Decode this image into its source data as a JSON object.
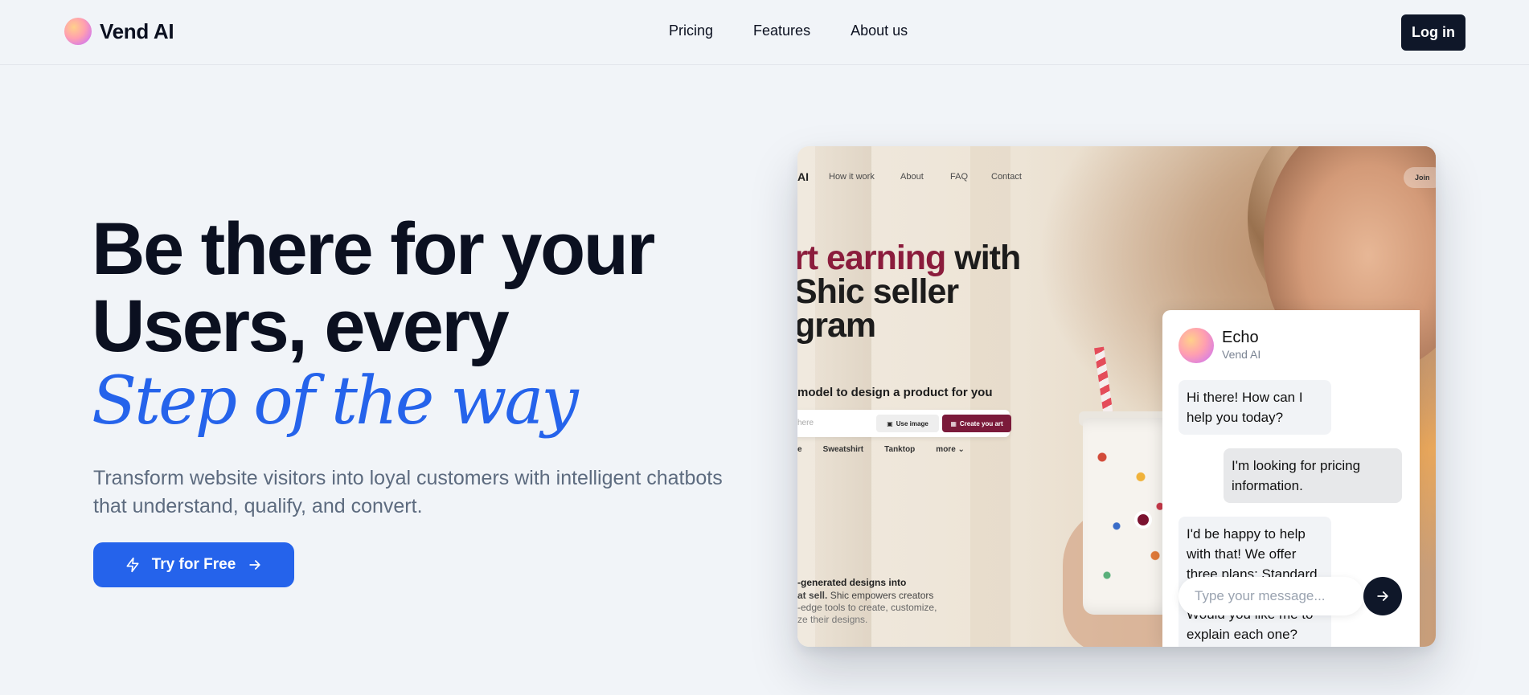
{
  "brand": {
    "name": "Vend AI"
  },
  "nav": {
    "items": [
      "Pricing",
      "Features",
      "About us"
    ],
    "login_label": "Log in"
  },
  "hero": {
    "title_line1": "Be there for your",
    "title_line2": "Users, every",
    "title_accent": "Step of the way",
    "subtitle": "Transform website visitors into loyal customers with intelligent chatbots that understand, qualify, and convert.",
    "cta_label": "Try for Free"
  },
  "preview": {
    "nav": {
      "logo": "AI",
      "links": [
        "How it work",
        "About",
        "FAQ",
        "Contact"
      ],
      "join": "Join"
    },
    "headline_pink": "rt earning",
    "headline_rest1": " with",
    "headline_line2": " Shic seller",
    "headline_line3": "gram",
    "model_text": "model to design a product for you",
    "search_placeholder": "here",
    "use_image": "Use image",
    "create_art": "Create you art",
    "tags": [
      "e",
      "Sweatshirt",
      "Tanktop",
      "more ⌄"
    ],
    "footer_line1": "-generated designs into",
    "footer_line2_bold": "at sell.",
    "footer_line2_rest": " Shic empowers creators",
    "footer_line3": "-edge tools to create, customize,",
    "footer_line4": "ze their designs."
  },
  "chat": {
    "name": "Echo",
    "subtitle": "Vend AI",
    "messages": [
      {
        "from": "bot",
        "text": "Hi there! How can I help you today?"
      },
      {
        "from": "user",
        "text": "I'm looking for pricing information."
      },
      {
        "from": "bot",
        "text": "I'd be happy to help with that! We offer three plans: Standard, Pro, and Enterprise. Would you like me to explain each one?"
      }
    ],
    "input_placeholder": "Type your message..."
  },
  "colors": {
    "accent": "#2563eb",
    "dark": "#0f1729",
    "background": "#f1f4f8",
    "preview_pink": "#8b1c3c"
  }
}
